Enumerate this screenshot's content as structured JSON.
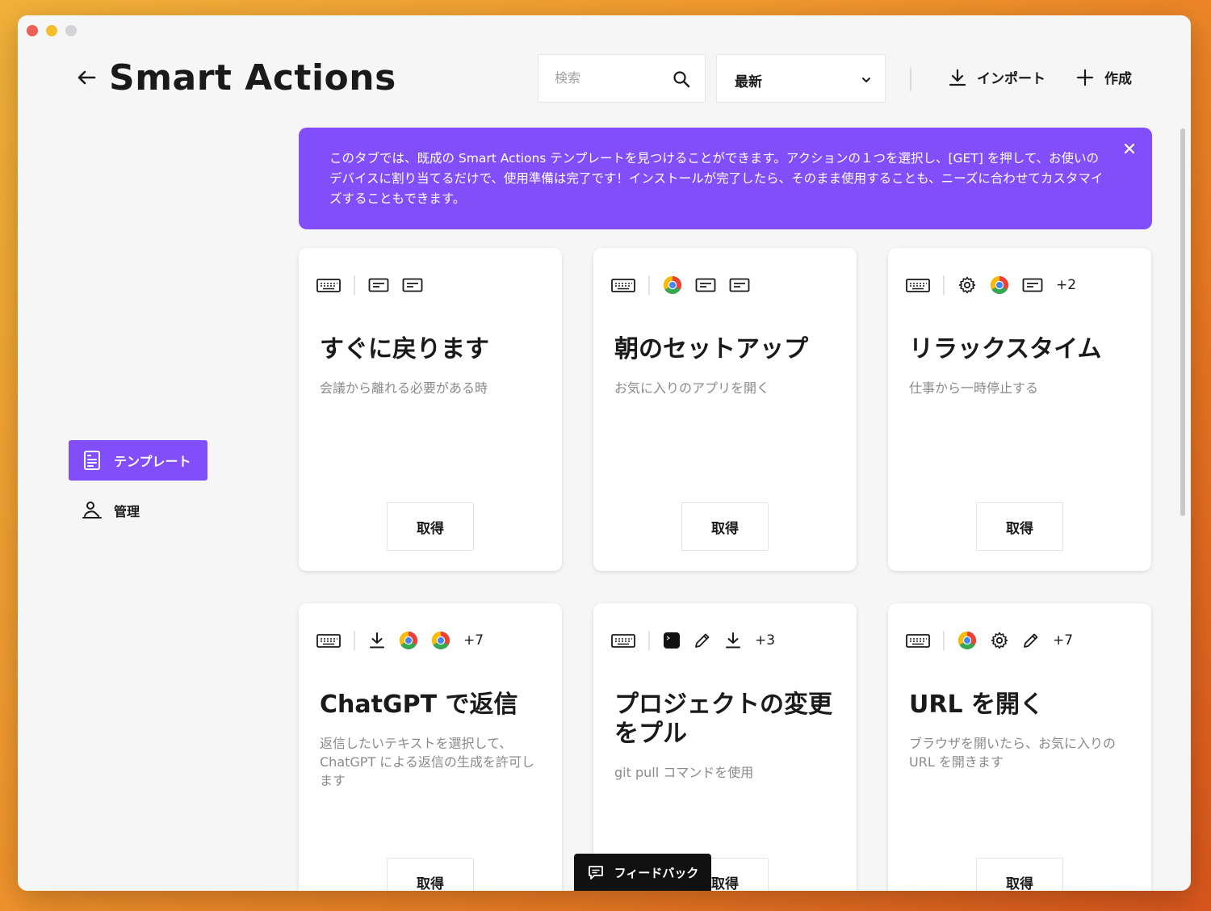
{
  "window": {
    "colors": {
      "close": "#ee5f56",
      "minimize": "#f4bd2e",
      "zoom": "#d3d3d6"
    }
  },
  "header": {
    "title": "Smart Actions",
    "back_icon": "arrow-left-icon"
  },
  "search": {
    "placeholder": "検索"
  },
  "sort": {
    "value": "最新"
  },
  "toolbar": {
    "import_label": "インポート",
    "create_label": "作成"
  },
  "sidebar": {
    "items": [
      {
        "label": "テンプレート",
        "active": true
      },
      {
        "label": "管理",
        "active": false
      }
    ]
  },
  "banner": {
    "text": "このタブでは、既成の Smart Actions テンプレートを見つけることができます。アクションの１つを選択し、[GET] を押して、お使いのデバイスに割り当てるだけで、使用準備は完了です！インストールが完了したら、そのまま使用することも、ニーズに合わせてカスタマイズすることもできます。"
  },
  "accent": "#814efa",
  "cards": [
    {
      "title": "すぐに戻ります",
      "description": "会議から離れる必要がある時",
      "icons": [
        "keyboard-icon",
        "window-icon",
        "window-icon"
      ],
      "more": "",
      "button": "取得"
    },
    {
      "title": "朝のセットアップ",
      "description": "お気に入りのアプリを開く",
      "icons": [
        "keyboard-icon",
        "chrome-icon",
        "window-icon",
        "window-icon"
      ],
      "more": "",
      "button": "取得"
    },
    {
      "title": "リラックスタイム",
      "description": "仕事から一時停止する",
      "icons": [
        "keyboard-icon",
        "settings-icon",
        "chrome-icon",
        "window-icon"
      ],
      "more": "+2",
      "button": "取得"
    },
    {
      "title": "ChatGPT で返信",
      "description": "返信したいテキストを選択して、ChatGPT による返信の生成を許可します",
      "icons": [
        "keyboard-icon",
        "download-icon",
        "chrome-icon",
        "chrome-icon"
      ],
      "more": "+7",
      "button": "取得"
    },
    {
      "title": "プロジェクトの変更をプル",
      "description": "git pull コマンドを使用",
      "icons": [
        "keyboard-icon",
        "terminal-icon",
        "pencil-icon",
        "download-icon"
      ],
      "more": "+3",
      "button": "取得"
    },
    {
      "title": "URL を開く",
      "description": "ブラウザを開いたら、お気に入りの URL を開きます",
      "icons": [
        "keyboard-icon",
        "chrome-icon",
        "settings-icon",
        "pencil-icon"
      ],
      "more": "+7",
      "button": "取得"
    }
  ],
  "feedback": {
    "label": "フィードバック"
  }
}
